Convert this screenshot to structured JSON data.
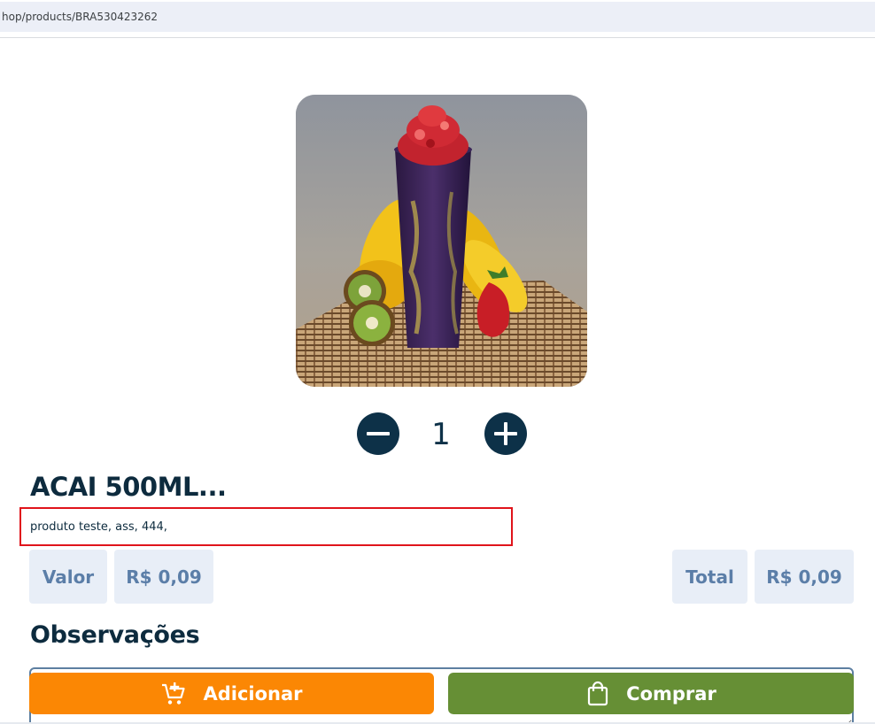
{
  "browser": {
    "url": "hop/products/BRA530423262"
  },
  "product": {
    "image_alt": "Acai cup with strawberries, bananas and kiwi",
    "quantity": "1",
    "title": "ACAI 500ML...",
    "description": "produto teste, ass, 444,"
  },
  "pricing": {
    "value_label": "Valor",
    "value": "R$ 0,09",
    "total_label": "Total",
    "total": "R$ 0,09"
  },
  "observations": {
    "title": "Observações",
    "placeholder": ""
  },
  "actions": {
    "add_label": "Adicionar",
    "buy_label": "Comprar"
  },
  "colors": {
    "primary_dark": "#0d3148",
    "add_button": "#fb8704",
    "buy_button": "#668f35",
    "chip_bg": "#e8eef7",
    "chip_text": "#5b7ea8",
    "highlight_border": "#e0141b"
  },
  "icons": {
    "minus": "minus-icon",
    "plus": "plus-icon",
    "add_cart": "cart-plus-icon",
    "buy": "shopping-bag-icon"
  }
}
